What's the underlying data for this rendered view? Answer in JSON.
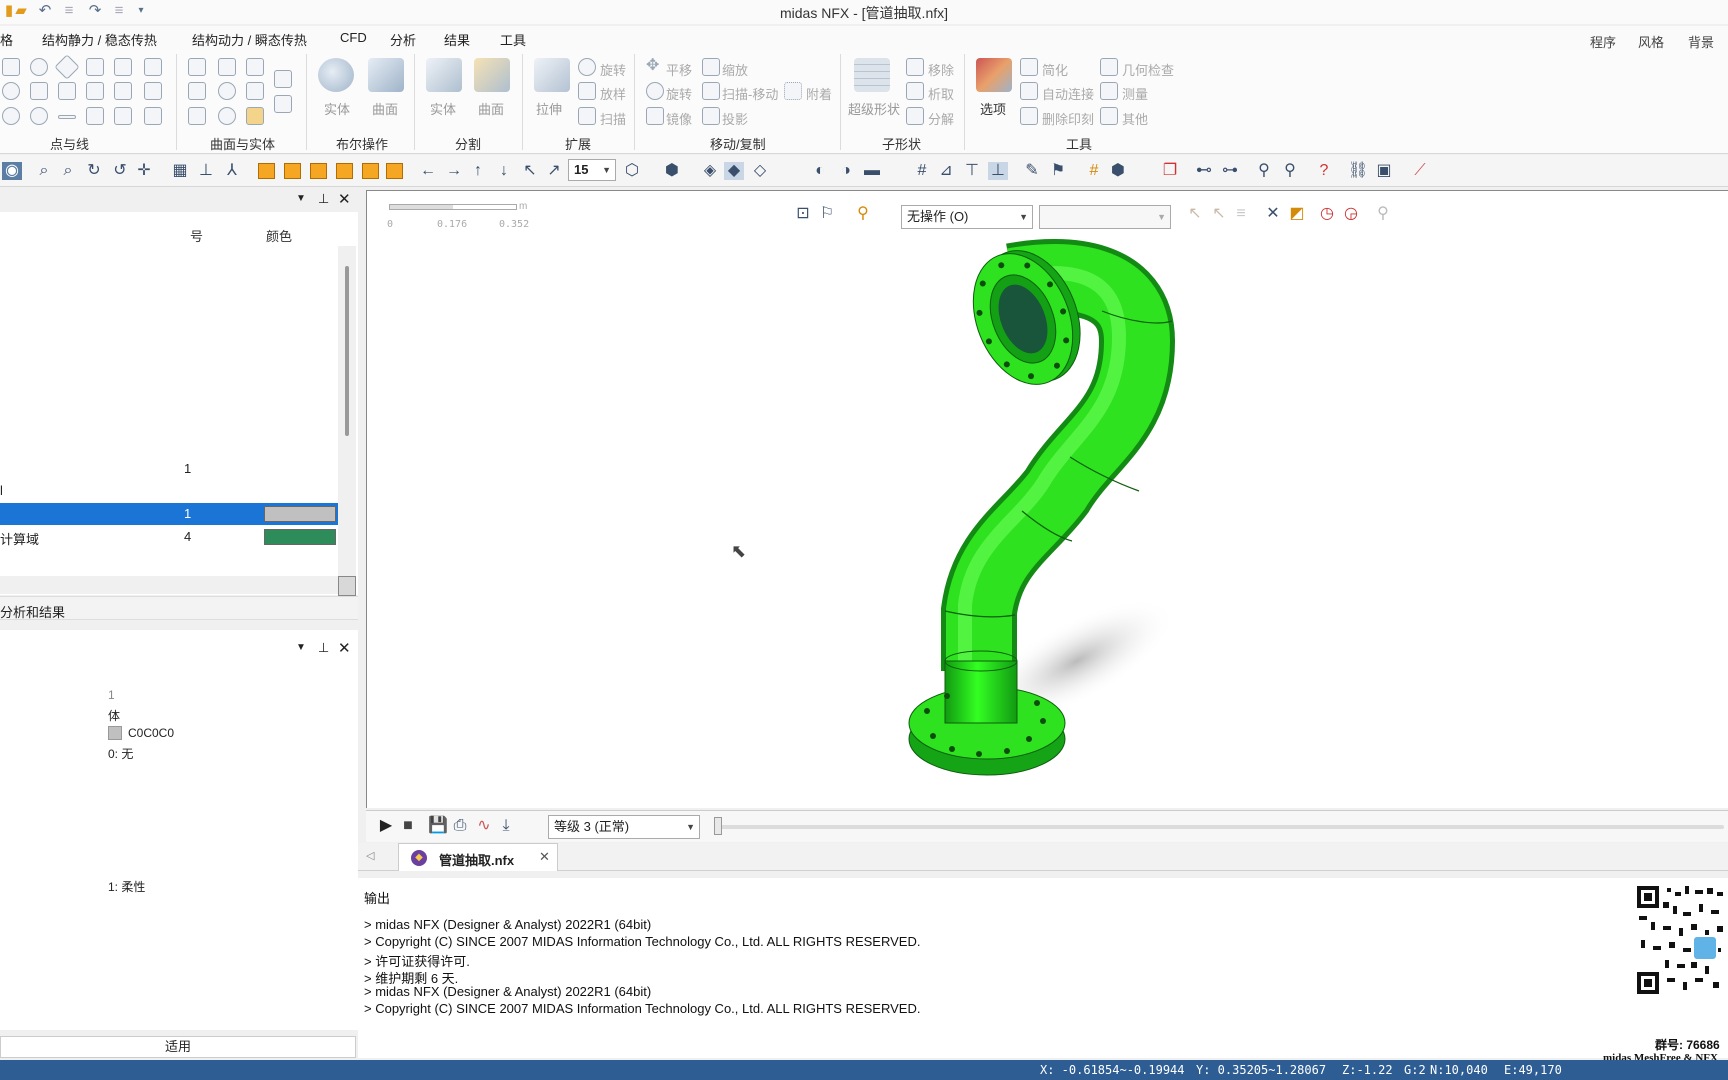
{
  "window": {
    "title": "midas NFX - [管道抽取.nfx]"
  },
  "menu": {
    "tabs": [
      "格",
      "结构静力 / 稳态传热",
      "结构动力 / 瞬态传热",
      "CFD",
      "分析",
      "结果",
      "工具"
    ],
    "right": [
      "程序",
      "风格",
      "背景"
    ]
  },
  "ribbon": {
    "groups": {
      "points_lines": "点与线",
      "surface_solid": "曲面与实体",
      "boolean": "布尔操作",
      "split": "分割",
      "extend": "扩展",
      "move_copy": "移动/复制",
      "subshape": "子形状",
      "tools": "工具"
    },
    "buttons": {
      "solid1": "实体",
      "surface1": "曲面",
      "solid2": "实体",
      "surface2": "曲面",
      "extrude": "拉伸",
      "revolve": "旋转",
      "loft": "放样",
      "sweep": "扫描",
      "translate": "平移",
      "rotate": "旋转",
      "mirror": "镜像",
      "scale": "缩放",
      "sweep_move": "扫描-移动",
      "project": "投影",
      "attach": "附着",
      "super_shape": "超级形状",
      "remove": "移除",
      "extract": "析取",
      "decompose": "分解",
      "options": "选项",
      "simplify": "简化",
      "auto_connect": "自动连接",
      "delete_imprint": "删除印刻",
      "geom_check": "几何检查",
      "measure": "测量",
      "other": "其他"
    }
  },
  "toolbar": {
    "angle_value": "15"
  },
  "works_panel": {
    "col_id": "号",
    "col_color": "颜色",
    "rows": [
      {
        "name": "",
        "id": "1",
        "color": null,
        "selected": false
      },
      {
        "name": "l",
        "id": "",
        "color": null,
        "selected": false
      },
      {
        "name": "",
        "id": "1",
        "color": "#c0c0c0",
        "selected": true
      },
      {
        "name": "计算域",
        "id": "4",
        "color": "#2e8b5a",
        "selected": false
      }
    ]
  },
  "analysis_tab": {
    "label": "分析和结果"
  },
  "properties": {
    "id": "1",
    "type": "体",
    "color_text": "C0C0C0",
    "color": "#c0c0c0",
    "coord": "0: 无",
    "property": "1: 柔性",
    "apply": "适用"
  },
  "viewport": {
    "scale_unit": "m",
    "scale_ticks": [
      "0",
      "0.176",
      "0.352"
    ],
    "operation_combo": "无操作 (O)",
    "model_color": "#22dd11"
  },
  "animation": {
    "level_combo": "等级 3 (正常)"
  },
  "document_tab": {
    "label": "管道抽取.nfx"
  },
  "output": {
    "title": "输出",
    "lines": [
      "> midas NFX (Designer & Analyst) 2022R1 (64bit)",
      "> Copyright (C) SINCE 2007 MIDAS Information Technology Co., Ltd. ALL RIGHTS RESERVED.",
      "> 许可证获得许可.",
      "> 维护期剩 6 天.",
      "> midas NFX (Designer & Analyst) 2022R1 (64bit)",
      "> Copyright (C) SINCE 2007 MIDAS Information Technology Co., Ltd. ALL RIGHTS RESERVED."
    ]
  },
  "watermark": {
    "group": "群号: 76686",
    "brand": "midas MeshFree & NFX"
  },
  "status": {
    "x": "X: -0.61854~-0.19944",
    "y": "Y: 0.35205~1.28067",
    "z": "Z:-1.22",
    "g": "G:2",
    "n": "N:10,040",
    "e": "E:49,170"
  }
}
